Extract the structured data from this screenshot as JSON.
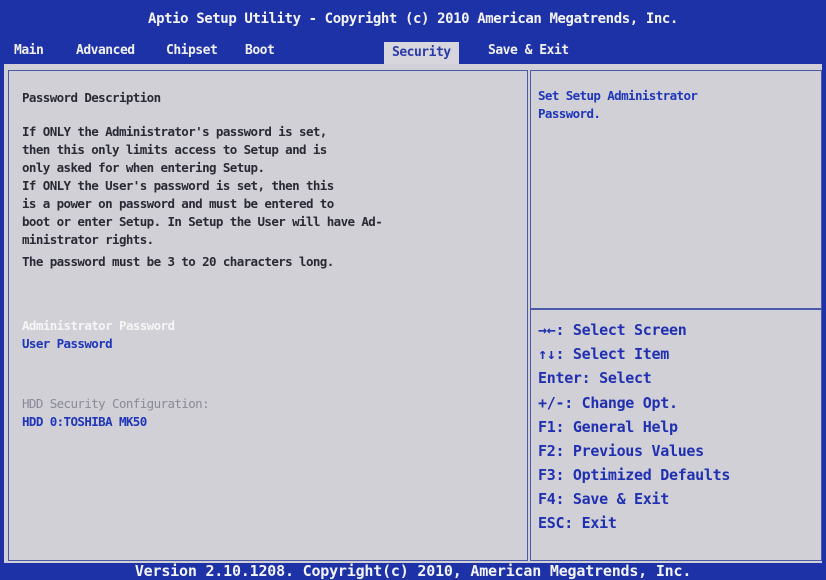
{
  "title": "Aptio Setup Utility - Copyright (c) 2010 American Megatrends, Inc.",
  "tabs": [
    {
      "label": "Main"
    },
    {
      "label": "Advanced"
    },
    {
      "label": "Chipset"
    },
    {
      "label": "Boot"
    },
    {
      "label": "Security"
    },
    {
      "label": "Save & Exit"
    }
  ],
  "active_tab": "Security",
  "description": {
    "heading": "Password Description",
    "lines": [
      "If ONLY the Administrator's password is set,",
      "then this only limits access to Setup and is",
      "only asked for when entering Setup.",
      "If ONLY the User's password is set, then this",
      "is a power on password and must be entered to",
      "boot or enter Setup.  In Setup the User will have Ad-",
      "ministrator rights.",
      "The password must be 3 to 20 characters long."
    ]
  },
  "items": {
    "admin_password": "Administrator Password",
    "user_password": "User Password",
    "hdd_config_label": "HDD Security Configuration:",
    "hdd_0": "HDD 0:TOSHIBA MK50"
  },
  "help": {
    "line1": "Set Setup Administrator",
    "line2": "Password."
  },
  "keys": [
    "→←: Select Screen",
    "↑↓: Select Item",
    "Enter: Select",
    "+/-: Change Opt.",
    "F1: General Help",
    "F2: Previous Values",
    "F3: Optimized Defaults",
    "F4: Save & Exit",
    "ESC: Exit"
  ],
  "footer": "Version 2.10.1208. Copyright(c) 2010, American Megatrends, Inc.",
  "colors": {
    "background_blue": "#1e32a8",
    "panel_grey": "#d0d0d6",
    "selected_text": "#f6f6f6",
    "item_blue": "#1f36b8"
  }
}
